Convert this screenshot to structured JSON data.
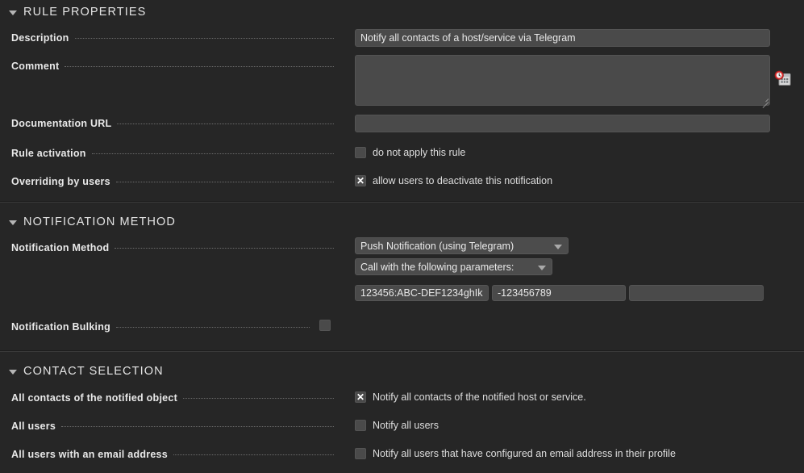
{
  "sections": {
    "rule_properties": {
      "title": "RULE PROPERTIES",
      "rows": {
        "description": {
          "label": "Description",
          "value": "Notify all contacts of a host/service via Telegram",
          "placeholder": ""
        },
        "comment": {
          "label": "Comment",
          "value": "",
          "placeholder": "",
          "icon": "calendar-clock-icon"
        },
        "documentation_url": {
          "label": "Documentation URL",
          "value": "",
          "placeholder": ""
        },
        "rule_activation": {
          "label": "Rule activation",
          "checkbox_label": "do not apply this rule",
          "checked": false
        },
        "overriding_by_users": {
          "label": "Overriding by users",
          "checkbox_label": "allow users to deactivate this notification",
          "checked": true
        }
      }
    },
    "notification_method": {
      "title": "NOTIFICATION METHOD",
      "rows": {
        "notification_method": {
          "label": "Notification Method",
          "method_select": "Push Notification (using Telegram)",
          "params_select": "Call with the following parameters:",
          "param_1": "123456:ABC-DEF1234ghIk",
          "param_2": "-123456789",
          "param_3": ""
        },
        "notification_bulking": {
          "label": "Notification Bulking",
          "checked": false
        }
      }
    },
    "contact_selection": {
      "title": "CONTACT SELECTION",
      "rows": {
        "all_contacts": {
          "label": "All contacts of the notified object",
          "checkbox_label": "Notify all contacts of the notified host or service.",
          "checked": true
        },
        "all_users": {
          "label": "All users",
          "checkbox_label": "Notify all users",
          "checked": false
        },
        "all_users_email": {
          "label": "All users with an email address",
          "checkbox_label": "Notify all users that have configured an email address in their profile",
          "checked": false
        }
      }
    }
  },
  "colors": {
    "page_background": "#262626",
    "field_background": "#4a4a4a",
    "label_text": "#e9e9e9",
    "header_text": "#e4e4e4",
    "divider": "#3a3a3a",
    "icon_accent_red": "#e03030"
  }
}
